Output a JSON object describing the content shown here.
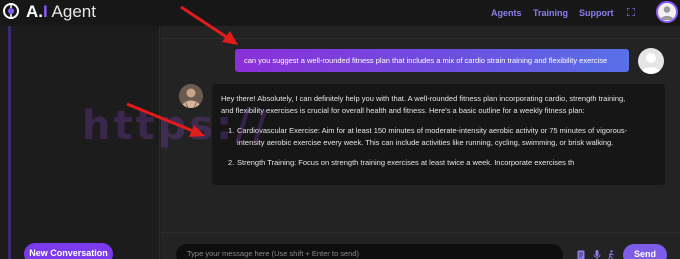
{
  "header": {
    "brand_a": "A",
    "brand_dot": ".",
    "brand_i": "I",
    "brand_rest": " Agent",
    "nav": [
      "Agents",
      "Training",
      "Support"
    ]
  },
  "sidebar": {
    "new_conversation_label": "New Conversation"
  },
  "chat": {
    "user_message": "can you suggest a well-rounded fitness plan that includes a mix of cardio strain training and flexibility exercise",
    "bot_intro_1": "Hey there! Absolutely, I can definitely help you with that. A well-rounded fitness plan incorporating cardio, strength training,",
    "bot_intro_2": "and flexibility exercises is crucial for overall health and fitness. Here's a basic outline for a weekly fitness plan:",
    "items": [
      {
        "num": "1.",
        "line1": "Cardiovascular Exercise: Aim for at least 150 minutes of moderate-intensity aerobic activity or 75 minutes of vigorous-",
        "line2": "intensity aerobic exercise every week. This can include activities like running, cycling, swimming, or brisk walking."
      },
      {
        "num": "2.",
        "line1": "Strength Training: Focus on strength training exercises at least twice a week. Incorporate exercises th",
        "line2": ""
      }
    ]
  },
  "composer": {
    "placeholder": "Type your message here (Use shift + Enter to send)",
    "send_label": "Send"
  },
  "watermark": "https://",
  "colors": {
    "accent": "#7c3aed",
    "nav": "#8b7ff0",
    "arrow": "#e21b1b"
  }
}
